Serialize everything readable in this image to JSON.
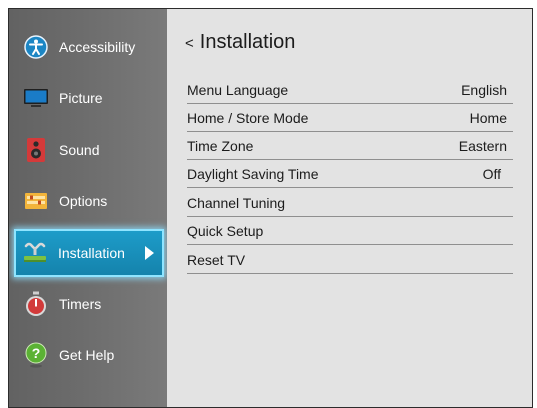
{
  "sidebar": {
    "items": [
      {
        "label": "Accessibility",
        "icon": "accessibility-icon"
      },
      {
        "label": "Picture",
        "icon": "picture-icon"
      },
      {
        "label": "Sound",
        "icon": "speaker-icon"
      },
      {
        "label": "Options",
        "icon": "options-icon"
      },
      {
        "label": "Installation",
        "icon": "installation-icon",
        "selected": true
      },
      {
        "label": "Timers",
        "icon": "timer-icon"
      },
      {
        "label": "Get Help",
        "icon": "help-icon"
      }
    ]
  },
  "main": {
    "back_symbol": "<",
    "title": "Installation",
    "rows": [
      {
        "label": "Menu Language",
        "value": "English"
      },
      {
        "label": "Home / Store Mode",
        "value": "Home"
      },
      {
        "label": "Time Zone",
        "value": "Eastern"
      },
      {
        "label": "Daylight Saving Time",
        "value": "Off"
      },
      {
        "label": "Channel Tuning",
        "value": ""
      },
      {
        "label": "Quick Setup",
        "value": ""
      },
      {
        "label": "Reset TV",
        "value": ""
      }
    ]
  },
  "colors": {
    "sidebar_bg": "#6a6a6a",
    "selected_bg": "#1a8fbc",
    "selected_glow": "#8fe4ff",
    "content_bg": "#e3e3e3",
    "divider": "#8f8f8f"
  }
}
